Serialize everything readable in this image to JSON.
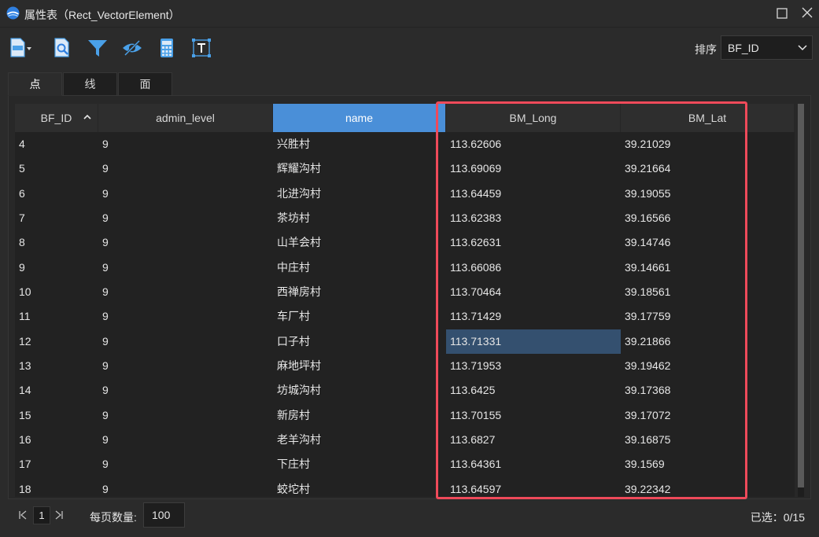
{
  "window": {
    "title": "属性表（Rect_VectorElement）"
  },
  "toolbar": {
    "buttons": [
      "export-csv-icon",
      "zoom-to-feature-icon",
      "filter-icon",
      "visibility-icon",
      "calculator-icon",
      "text-label-icon"
    ],
    "sort_label": "排序",
    "sort_value": "BF_ID"
  },
  "tabs": [
    {
      "label": "点",
      "active": true
    },
    {
      "label": "线",
      "active": false
    },
    {
      "label": "面",
      "active": false
    }
  ],
  "table": {
    "columns": [
      "BF_ID",
      "admin_level",
      "name",
      "BM_Long",
      "BM_Lat"
    ],
    "sorted_column": "BF_ID",
    "highlighted_column": "name",
    "selected_cell": {
      "row": 8,
      "column": "BM_Long"
    },
    "rows": [
      [
        "4",
        "9",
        "兴胜村",
        "113.62606",
        "39.21029"
      ],
      [
        "5",
        "9",
        "辉耀沟村",
        "113.69069",
        "39.21664"
      ],
      [
        "6",
        "9",
        "北进沟村",
        "113.64459",
        "39.19055"
      ],
      [
        "7",
        "9",
        "茶坊村",
        "113.62383",
        "39.16566"
      ],
      [
        "8",
        "9",
        "山羊会村",
        "113.62631",
        "39.14746"
      ],
      [
        "9",
        "9",
        "中庄村",
        "113.66086",
        "39.14661"
      ],
      [
        "10",
        "9",
        "西禅房村",
        "113.70464",
        "39.18561"
      ],
      [
        "11",
        "9",
        "车厂村",
        "113.71429",
        "39.17759"
      ],
      [
        "12",
        "9",
        "口子村",
        "113.71331",
        "39.21866"
      ],
      [
        "13",
        "9",
        "麻地坪村",
        "113.71953",
        "39.19462"
      ],
      [
        "14",
        "9",
        "坊城沟村",
        "113.6425",
        "39.17368"
      ],
      [
        "15",
        "9",
        "新房村",
        "113.70155",
        "39.17072"
      ],
      [
        "16",
        "9",
        "老羊沟村",
        "113.6827",
        "39.16875"
      ],
      [
        "17",
        "9",
        "下庄村",
        "113.64361",
        "39.1569"
      ],
      [
        "18",
        "9",
        "蛟坨村",
        "113.64597",
        "39.22342"
      ]
    ]
  },
  "pager": {
    "current_page": "1",
    "page_size_label": "每页数量:",
    "page_size": "100",
    "selected_count": "已选：0/15"
  },
  "colors": {
    "background": "#2b2b2b",
    "highlighted_header": "#4a8fd8",
    "selected_cell": "#34506f",
    "annotation_box": "#ef4a5a",
    "icon_blue": "#4aa0e8"
  }
}
